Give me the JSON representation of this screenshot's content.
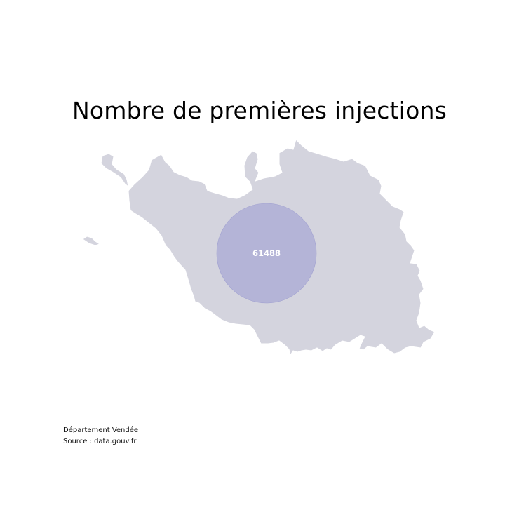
{
  "title": "Nombre de premières injections",
  "map": {
    "region": "Vendée",
    "value": "61488",
    "land_color": "#d4d4de",
    "bubble_color": "#a9a9d4",
    "label_color": "#ffffff"
  },
  "footer": {
    "line1": "Département Vendée",
    "line2": "Source : data.gouv.fr"
  }
}
